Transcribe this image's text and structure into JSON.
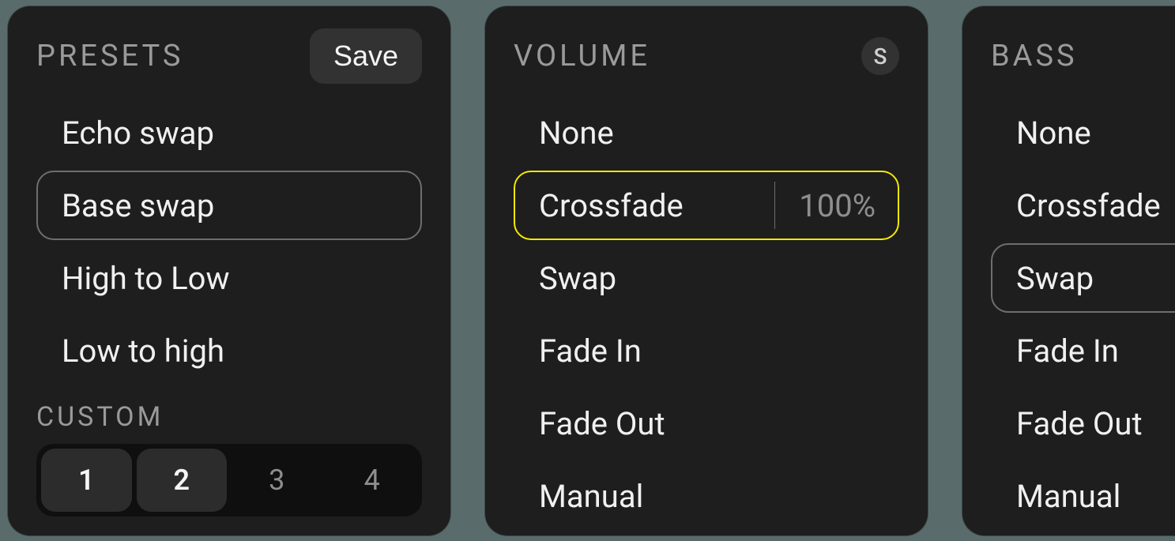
{
  "presets": {
    "title": "PRESETS",
    "save_label": "Save",
    "items": [
      {
        "label": "Echo swap",
        "selected": false
      },
      {
        "label": "Base swap",
        "selected": true
      },
      {
        "label": "High to Low",
        "selected": false
      },
      {
        "label": "Low to high",
        "selected": false
      }
    ],
    "custom_label": "CUSTOM",
    "custom_slots": [
      {
        "label": "1",
        "filled": true
      },
      {
        "label": "2",
        "filled": true
      },
      {
        "label": "3",
        "filled": false
      },
      {
        "label": "4",
        "filled": false
      }
    ]
  },
  "volume": {
    "title": "VOLUME",
    "badge": "S",
    "items": [
      {
        "label": "None",
        "selected": false
      },
      {
        "label": "Crossfade",
        "selected": true,
        "value": "100%"
      },
      {
        "label": "Swap",
        "selected": false
      },
      {
        "label": "Fade In",
        "selected": false
      },
      {
        "label": "Fade Out",
        "selected": false
      },
      {
        "label": "Manual",
        "selected": false
      }
    ]
  },
  "bass": {
    "title": "BASS",
    "items": [
      {
        "label": "None",
        "selected": false
      },
      {
        "label": "Crossfade",
        "selected": false
      },
      {
        "label": "Swap",
        "selected": true
      },
      {
        "label": "Fade In",
        "selected": false
      },
      {
        "label": "Fade Out",
        "selected": false
      },
      {
        "label": "Manual",
        "selected": false
      }
    ]
  }
}
